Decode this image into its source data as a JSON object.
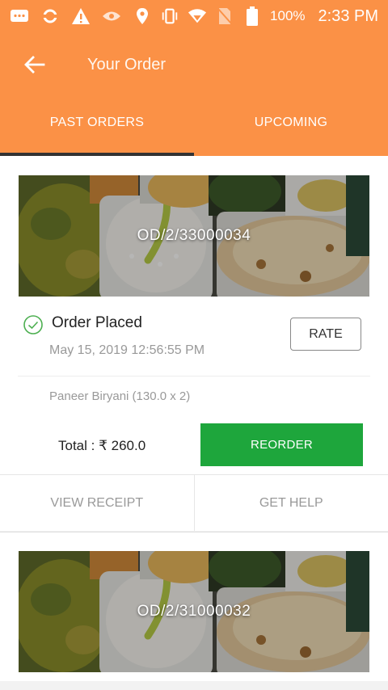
{
  "status_bar": {
    "battery": "100%",
    "time": "2:33 PM",
    "icons": [
      "message-icon",
      "sync-icon",
      "warning-icon",
      "eye-icon",
      "location-icon",
      "vibrate-icon",
      "wifi-icon",
      "no-sim-icon",
      "battery-icon"
    ]
  },
  "app_bar": {
    "title": "Your Order",
    "back_icon": "arrow-left-icon"
  },
  "tabs": [
    {
      "label": "PAST ORDERS",
      "active": true
    },
    {
      "label": "UPCOMING",
      "active": false
    }
  ],
  "orders": [
    {
      "order_id": "OD/2/33000034",
      "status": "Order Placed",
      "datetime": "May 15, 2019 12:56:55 PM",
      "rate_label": "RATE",
      "items": "Paneer Biryani (130.0 x 2)",
      "total_label": "Total : ₹  260.0",
      "reorder_label": "REORDER",
      "view_receipt_label": "VIEW RECEIPT",
      "get_help_label": "GET HELP"
    },
    {
      "order_id": "OD/2/31000032"
    }
  ],
  "colors": {
    "accent": "#fb9146",
    "reorder": "#1ea63c",
    "check": "#4caf50"
  }
}
